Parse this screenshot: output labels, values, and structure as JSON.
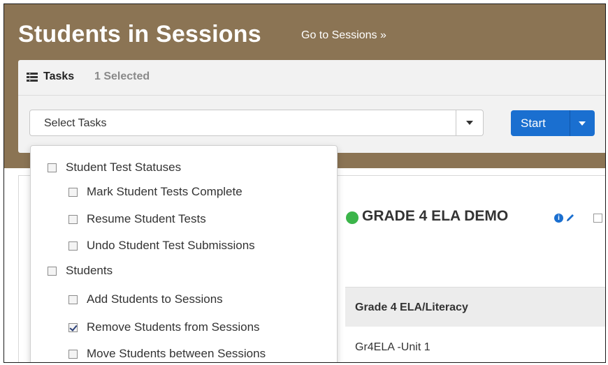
{
  "header": {
    "title": "Students in Sessions",
    "link": "Go to Sessions »"
  },
  "tasks": {
    "label": "Tasks",
    "selected": "1 Selected",
    "select_value": "Select Tasks",
    "start_label": "Start",
    "dropdown": [
      {
        "label": "Student Test Statuses",
        "level": "group",
        "checked": false
      },
      {
        "label": "Mark Student Tests Complete",
        "level": "item",
        "checked": false
      },
      {
        "label": "Resume Student Tests",
        "level": "item",
        "checked": false
      },
      {
        "label": "Undo Student Test Submissions",
        "level": "item",
        "checked": false
      },
      {
        "label": "Students",
        "level": "group",
        "checked": false
      },
      {
        "label": "Add Students to Sessions",
        "level": "item",
        "checked": false
      },
      {
        "label": "Remove Students from Sessions",
        "level": "item",
        "checked": true
      },
      {
        "label": "Move Students between Sessions",
        "level": "item",
        "checked": false
      }
    ]
  },
  "session": {
    "title": "GRADE 4 ELA DEMO",
    "status_color": "#3bb54a",
    "info_icon": "i"
  },
  "unit_table": {
    "header": "Grade 4 ELA/Literacy",
    "rows": [
      "Gr4ELA -Unit 1"
    ]
  },
  "colors": {
    "hero": "#8b7454",
    "primary": "#1a6fd0"
  }
}
